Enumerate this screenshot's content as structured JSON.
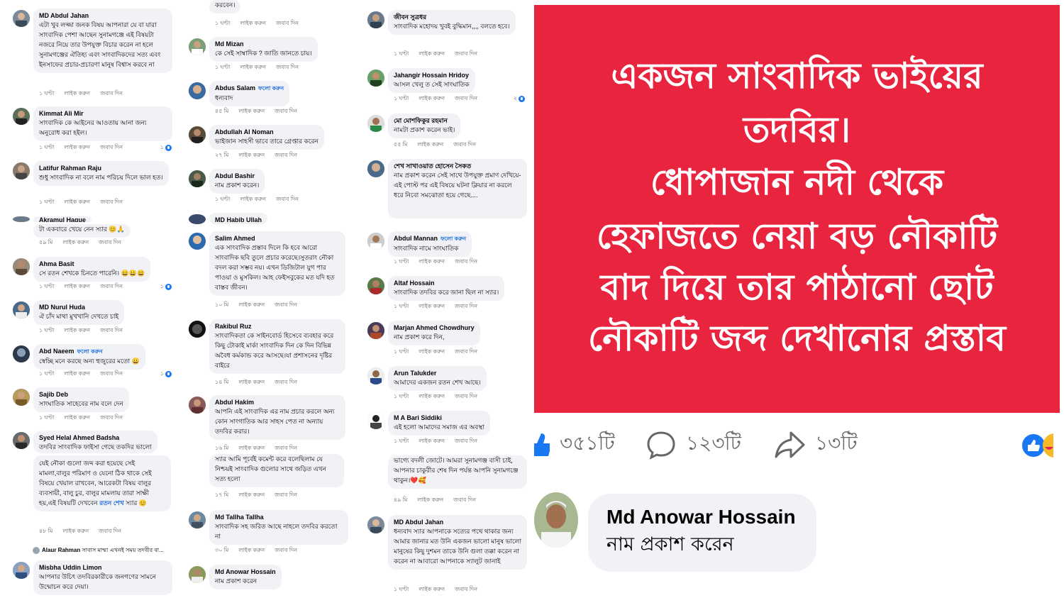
{
  "meta_labels": {
    "like": "লাইক করুন",
    "reply": "জবাব দিন"
  },
  "follow_label": "ফলো করুন",
  "column1": [
    {
      "author": "MD Abdul Jahan",
      "text": "এটা খুব লজ্জা জনক বিষয় আপনারা যে বা যারা  সাংবাদিক পেশা আছেন সুনামগঞ্জে এই বিষয়টা নজরে নিয়ে তার উপযুক্ত বিচার করেন না হলে সুনামগঞ্জের ঐতিহ্য এবং সাংবাদিকদের সত্য এবং ইনসাফের প্রচার-প্রচারণা মানুষ বিশ্বাস করবে না",
      "time": "১ ঘণ্টা"
    },
    {
      "author": "Kimmat Ali Mir",
      "text": "সাংবাদিক কে আইনের আওতায় আনা জন্য অনুরোধ করা হইল।",
      "time": "১ ঘণ্টা",
      "reactions": "১"
    },
    {
      "author": "Latifur Rahman Raju",
      "text": "শুধু সাংবাদিক না বলে নাম পরিচয় দিলে ভাল হত।",
      "time": "১ ঘণ্টা"
    },
    {
      "author": "Akramul Haque",
      "text": "টা একবারে খেয়ে নেন স্যার 😊🙏",
      "time": "৫৯ মি"
    },
    {
      "author": "Ahma Basit",
      "text": "সে রতন শেখকে চিনতে পারেনি। 😀😀😀",
      "time": "১ ঘণ্টা",
      "reactions": "১"
    },
    {
      "author": "MD Nurul Huda",
      "text": "ঐ চাঁদ মাথা মুখখানি দেখতে চাই",
      "time": "১ ঘণ্টা"
    },
    {
      "author": "Abd Naeem",
      "follow": true,
      "text": "স্বেচ্ছি মনে করছে অন্য হুজুরের মতো 😀",
      "time": "১ ঘণ্টা",
      "reactions": "১"
    },
    {
      "author": "Sajib Deb",
      "text": "সাংঘাতিক সাহেবের নাম বলে দেন",
      "time": "১ ঘণ্টা"
    },
    {
      "author": "Syed Helal Ahmed Badsha",
      "text": "তদবির সাংবাদিক ফাইসা গেছে তকদির ভালো",
      "time": ""
    },
    {
      "author": "",
      "text": "যেই নৌকা গুলো জব্দ করা হয়েছে সেই মামলা,বালুর পরিমাণ ও যেনো ঠিক থাকে সেই বিষয়ে খেয়াল রাখবেন, আরেকটা বিষয় বালুর ব্যবসায়ী, বালু চুর, বালুর মামলায় তারা সাক্ষী হয়,এই বিষয়টি দেখবেন",
      "link": "রতন শেখ",
      "text_after": "স্যার 😊",
      "time": "৪৮ মি"
    },
    {
      "reply_author": "Alaur Rahman",
      "reply_text": "সাবাস মাম্মা এখনই সময় তদবীর বা..."
    },
    {
      "author": "Misbha Uddin Limon",
      "text": "আপনার উচিৎ তদবিরকারীকে জনগণের সামনে উন্মোচন করে দেয়া।",
      "time": ""
    }
  ],
  "column2": [
    {
      "text": "করবেন।",
      "time": "১ ঘণ্টা"
    },
    {
      "author": "Md Mizan",
      "text": "কে সেই সাম্বাদিক ?  জাতি জানতে চায়।",
      "time": "১ ঘণ্টা"
    },
    {
      "author": "Abdus Salam",
      "follow": true,
      "text": "ধন্যবাদ",
      "time": "৪৫ মি"
    },
    {
      "author": "Abdullah Al Noman",
      "text": "ভাইজান সাহসী ভাবে তারে গ্রেপ্তার করেন",
      "time": "২৭ মি"
    },
    {
      "author": "Abdul Bashir",
      "text": "নাম প্রকাশ করেন।",
      "time": "১ ঘণ্টা"
    },
    {
      "author": "MD Habib Ullah",
      "text": "",
      "time": ""
    },
    {
      "author": "Salim Ahmed",
      "text": "এক সাংবাদিক প্রস্তাব দিলে কি হবে আরো সাংবাদিক ছবি তুলে প্রচার করেছে।সুতরাং নৌকা বদল করা সম্ভব নয়। এখন ডিজিটাল যুগ পার পাওয়া ও মুসকিল। আহ ফেইসবুকের মত যদি হত বাস্তব জীবন।",
      "time": "১০ মি"
    },
    {
      "author": "Rakibul Ruz",
      "text": "সাংবাদিকতা কে সাইনবোর্ড হিসেবে ব্যবহার করে কিছু টোকাই মার্কা সাংবাদিক দিন কে দিন বিভিন্ন অবৈধ কর্মকান্ড করে আসছে।যা প্রশাসনের দৃষ্টির বাইরে",
      "time": "১৪ মি"
    },
    {
      "author": "Abdul Hakim",
      "text": "আপনি এই সাংবাদিক এর নাম প্রচার করলে অন্য কোন সাংগাতিক আর সাহস পেত না অন্যায় তদবির করার।",
      "time": "১৬ মি"
    },
    {
      "text": "স্যার আমি পূর্বেই কমেন্ট করে বলেছিলাম যে নিশ্চয়ই সাংবাদিক গুলোর সাথে জড়িত এখন সত্য হলো",
      "time": "১৭ মি"
    },
    {
      "author": "Md Tallha Tallha",
      "text": "সাংবাদিক সহ জরিত আছে নাহলে তদবির করতো না",
      "time": "৩০ মি"
    },
    {
      "author": "Md Anowar Hossain",
      "text": "নাম প্রকাশ করেন",
      "time": ""
    }
  ],
  "column3": [
    {
      "author": "জীবন সুত্রধর",
      "text": "সাংবাদিক মহোদয় খুবই বুদ্ধিমান,,,, বলতে হবে।",
      "time": "১ ঘণ্টা"
    },
    {
      "author": "Jahangir Hossain Hridoy",
      "text": "আসল খেলু ত সেই সাংঘাতিক",
      "time": "১ ঘণ্টা",
      "reactions": "২"
    },
    {
      "author": "মো মোশফিকুর রহমান",
      "text": "নামটা প্রকাশ করেন ভাই।",
      "time": "৫৫ মি"
    },
    {
      "author": "শেখ সাখাওয়াত হোসেন সৈকত",
      "text": "নাম প্রকাশ করেন সেই সাথে উপযুক্ত প্রমাণ দেখিয়ে- এই পোস্ট পর এই বিষয়ে ঘটনা ক্লিয়ার না করলে ধরে নিবো সমঝোতা হয়ে গেছে.... ",
      "time": ""
    },
    {
      "author": "Abdul Mannan",
      "follow": true,
      "text": "সাংবাদিক নামে সাংঘাতিক",
      "time": "১ ঘণ্টা"
    },
    {
      "author": "Altaf Hossain",
      "text": "সাংবাদিক তদবির করে জানা ছিল না স্যার।",
      "time": "১ ঘণ্টা"
    },
    {
      "author": "Marjan Ahmed Chowdhury",
      "text": "নাম প্রকাশ করে দিন,",
      "time": "১ ঘণ্টা"
    },
    {
      "author": "Arun Talukder",
      "text": "আমাদের  একজন রতন শেখ  আছে।",
      "time": "১ ঘণ্টা"
    },
    {
      "author": "M A Bari Siddiki",
      "text": "এই হলো আমাদের সমাজ এর অবস্থা",
      "time": "১ ঘণ্টা"
    },
    {
      "text": "ভাগ্যে বদলী জোটে। আমরা সুনামগঞ্জ বাসী চাই, আপনার চাকুরীর শেষ দিন পর্যন্ত আপনি সুনামগঞ্জে থাকুন।❤️🥰",
      "time": "৪৯ মি"
    },
    {
      "author": "MD Abdul Jahan",
      "text": "ধন্যবাদ স্যার আপনাকে সত্যের পথে থাকার জন্য আমার জানার মত উনি একজন  ভালো মানুষ ভালো মানুষের কিছু দুশমন তাকে  উনি গুলা তক্কা করেন না করেন না আবারো আপনাকে স্যালুট জানাই",
      "time": "১ ঘণ্টা"
    }
  ],
  "post": {
    "lines": [
      "একজন সাংবাদিক ভাইয়ের",
      "তদবির।",
      "ধোপাজান নদী থেকে",
      "হেফাজতে নেয়া বড় নৌকাটি",
      "বাদ দিয়ে তার পাঠানো ছোট",
      "নৌকাটি জব্দ দেখানোর প্রস্তাব"
    ],
    "background_color": "#e8243f",
    "likes": "৩৫১টি",
    "comments": "১২৩টি",
    "shares": "১৩টি",
    "comment_author": "Md Anowar Hossain",
    "comment_text": "নাম প্রকাশ করেন"
  }
}
